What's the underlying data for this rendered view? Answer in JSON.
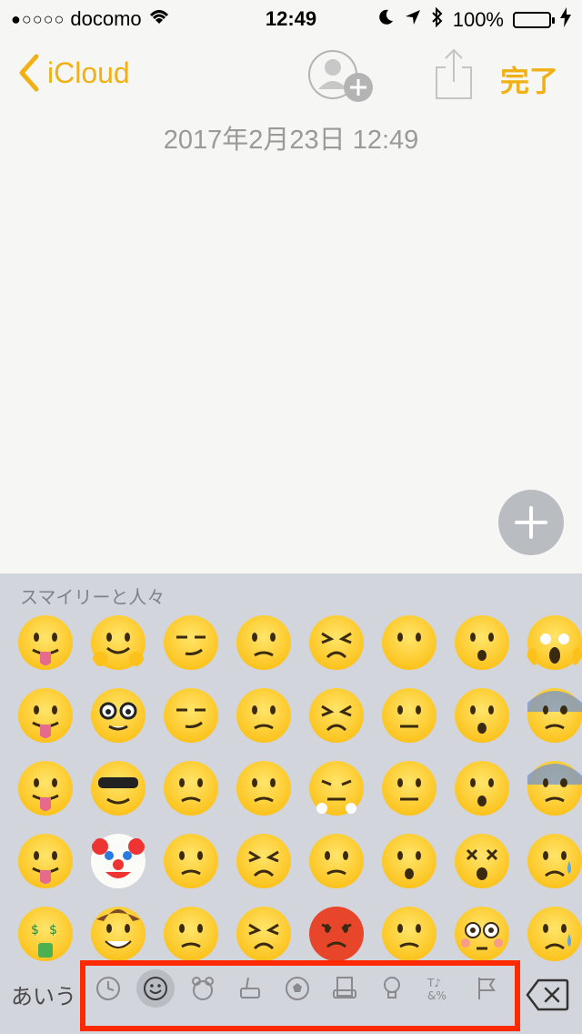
{
  "status_bar": {
    "carrier": "docomo",
    "signal_dots": "●○○○○",
    "time": "12:49",
    "battery": "100%",
    "battery_color": "#4cd964"
  },
  "nav": {
    "back_label": "iCloud",
    "done_label": "完了",
    "accent_color": "#f1b116"
  },
  "note": {
    "date": "2017年2月23日 12:49"
  },
  "keyboard": {
    "category_title": "スマイリーと人々",
    "abc_label": "あいう",
    "categories": [
      {
        "name": "recent-icon"
      },
      {
        "name": "smiley-icon",
        "active": true
      },
      {
        "name": "animal-icon"
      },
      {
        "name": "food-icon"
      },
      {
        "name": "sports-icon"
      },
      {
        "name": "travel-icon"
      },
      {
        "name": "objects-icon"
      },
      {
        "name": "symbols-icon"
      },
      {
        "name": "flags-icon"
      }
    ],
    "emoji_rows": [
      [
        "yum",
        "hugging",
        "smirk",
        "confused",
        "tired",
        "no-mouth",
        "hushed",
        "scream"
      ],
      [
        "winking-tongue",
        "nerd",
        "unamused",
        "slightly-frowning",
        "weary",
        "neutral",
        "open-mouth",
        "fearful"
      ],
      [
        "squinting-tongue",
        "sunglasses",
        "disappointed",
        "frowning",
        "steam",
        "expressionless",
        "astonished",
        "cold-sweat"
      ],
      [
        "tongue",
        "clown",
        "pensive",
        "confounded",
        "angry",
        "hushed-2",
        "dizzy",
        "crying"
      ],
      [
        "money-mouth",
        "cowboy",
        "worried",
        "persevering",
        "pouting",
        "frowning-open",
        "flushed",
        "sad-relieved"
      ]
    ]
  }
}
